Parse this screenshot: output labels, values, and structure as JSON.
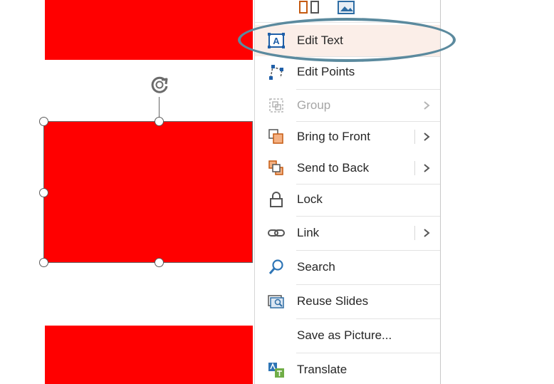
{
  "slide": {
    "shape_color": "#ff0000",
    "shapes": [
      "top-rectangle",
      "selected-rectangle",
      "bottom-rectangle"
    ]
  },
  "context_menu": {
    "top_icons": [
      "shape-format-icon",
      "picture-format-icon"
    ],
    "items": [
      {
        "label": "Edit Text",
        "icon": "edit-text-icon",
        "submenu": false,
        "disabled": false,
        "highlighted": true
      },
      {
        "label": "Edit Points",
        "icon": "edit-points-icon",
        "submenu": false,
        "disabled": false
      },
      {
        "label": "Group",
        "icon": "group-icon",
        "submenu": true,
        "disabled": true
      },
      {
        "label": "Bring to Front",
        "icon": "bring-to-front-icon",
        "submenu": true,
        "disabled": false
      },
      {
        "label": "Send to Back",
        "icon": "send-to-back-icon",
        "submenu": true,
        "disabled": false
      },
      {
        "label": "Lock",
        "icon": "lock-icon",
        "submenu": false,
        "disabled": false
      },
      {
        "label": "Link",
        "icon": "link-icon",
        "submenu": true,
        "disabled": false
      },
      {
        "label": "Search",
        "icon": "search-icon",
        "submenu": false,
        "disabled": false
      },
      {
        "label": "Reuse Slides",
        "icon": "reuse-slides-icon",
        "submenu": false,
        "disabled": false
      },
      {
        "label": "Save as Picture...",
        "icon": "",
        "submenu": false,
        "disabled": false
      },
      {
        "label": "Translate",
        "icon": "translate-icon",
        "submenu": false,
        "disabled": false
      }
    ]
  },
  "annotation": {
    "callout_color": "#5b8a9e",
    "highlight_color": "#fbeee8"
  }
}
